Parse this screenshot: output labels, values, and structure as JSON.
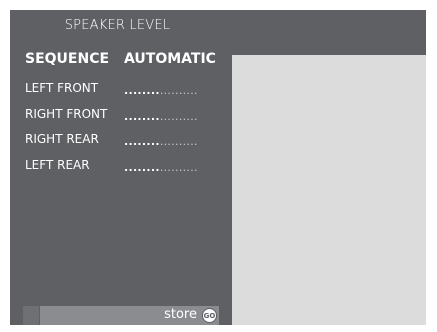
{
  "menu": {
    "title": "SPEAKER LEVEL",
    "header": {
      "label": "SEQUENCE",
      "value": "AUTOMATIC"
    },
    "items": [
      {
        "label": "LEFT FRONT",
        "level_bright": "........",
        "level_dim": ".........."
      },
      {
        "label": "RIGHT FRONT",
        "level_bright": "........",
        "level_dim": ".........."
      },
      {
        "label": "RIGHT REAR",
        "level_bright": "........",
        "level_dim": ".........."
      },
      {
        "label": "LEFT REAR",
        "level_bright": "........",
        "level_dim": ".........."
      }
    ]
  },
  "footer": {
    "store_label": "store",
    "go_label": "GO",
    "go_icon": "go-button-icon"
  },
  "colors": {
    "panel": "#5e6064",
    "preview": "#dcdcdc",
    "bar": "#8a8c90",
    "text": "#ffffff"
  }
}
